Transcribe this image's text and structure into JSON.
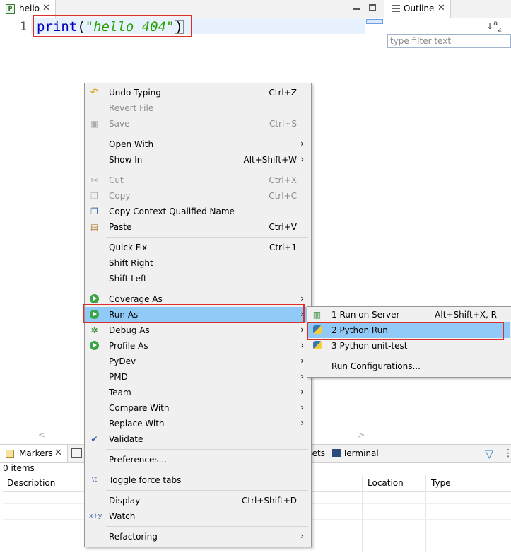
{
  "editor": {
    "tab_label": "hello",
    "line_number": "1",
    "code": {
      "func": "print",
      "open": "(",
      "string": "\"hello 404\"",
      "close": ")"
    }
  },
  "outline": {
    "tab_label": "Outline",
    "filter_placeholder": "type filter text"
  },
  "bottom": {
    "markers_label": "Markers",
    "snippets_label": "pets",
    "terminal_label": "Terminal",
    "item_count": "0 items",
    "columns": [
      "Description",
      "Location",
      "Type"
    ]
  },
  "context_menu": {
    "items": [
      {
        "label": "Undo Typing",
        "shortcut": "Ctrl+Z",
        "icon": "undo-icon"
      },
      {
        "label": "Revert File",
        "shortcut": "",
        "disabled": true
      },
      {
        "label": "Save",
        "shortcut": "Ctrl+S",
        "disabled": true,
        "icon": "save-icon"
      },
      {
        "label": "Open With",
        "submenu": true
      },
      {
        "label": "Show In",
        "shortcut": "Alt+Shift+W",
        "submenu": true
      },
      {
        "label": "Cut",
        "shortcut": "Ctrl+X",
        "disabled": true,
        "icon": "cut-icon"
      },
      {
        "label": "Copy",
        "shortcut": "Ctrl+C",
        "disabled": true,
        "icon": "copy-icon"
      },
      {
        "label": "Copy Context Qualified Name",
        "icon": "copy-qualified-icon"
      },
      {
        "label": "Paste",
        "shortcut": "Ctrl+V",
        "icon": "paste-icon"
      },
      {
        "label": "Quick Fix",
        "shortcut": "Ctrl+1"
      },
      {
        "label": "Shift Right"
      },
      {
        "label": "Shift Left"
      },
      {
        "label": "Coverage As",
        "submenu": true,
        "icon": "coverage-icon"
      },
      {
        "label": "Run As",
        "submenu": true,
        "icon": "run-icon",
        "highlighted": true
      },
      {
        "label": "Debug As",
        "submenu": true,
        "icon": "debug-icon"
      },
      {
        "label": "Profile As",
        "submenu": true,
        "icon": "profile-icon"
      },
      {
        "label": "PyDev",
        "submenu": true
      },
      {
        "label": "PMD",
        "submenu": true
      },
      {
        "label": "Team",
        "submenu": true
      },
      {
        "label": "Compare With",
        "submenu": true
      },
      {
        "label": "Replace With",
        "submenu": true
      },
      {
        "label": "Validate",
        "icon": "check-icon"
      },
      {
        "label": "Preferences..."
      },
      {
        "label": "Toggle force tabs",
        "icon": "tabs-toggle-icon"
      },
      {
        "label": "Display",
        "shortcut": "Ctrl+Shift+D"
      },
      {
        "label": "Watch",
        "icon": "watch-icon"
      },
      {
        "label": "Refactoring",
        "submenu": true
      }
    ]
  },
  "run_as_submenu": {
    "items": [
      {
        "label": "1 Run on Server",
        "shortcut": "Alt+Shift+X, R",
        "icon": "server-icon"
      },
      {
        "label": "2 Python Run",
        "icon": "python-icon",
        "highlighted": true
      },
      {
        "label": "3 Python unit-test",
        "icon": "python-unittest-icon"
      },
      {
        "label": "Run Configurations..."
      }
    ]
  }
}
